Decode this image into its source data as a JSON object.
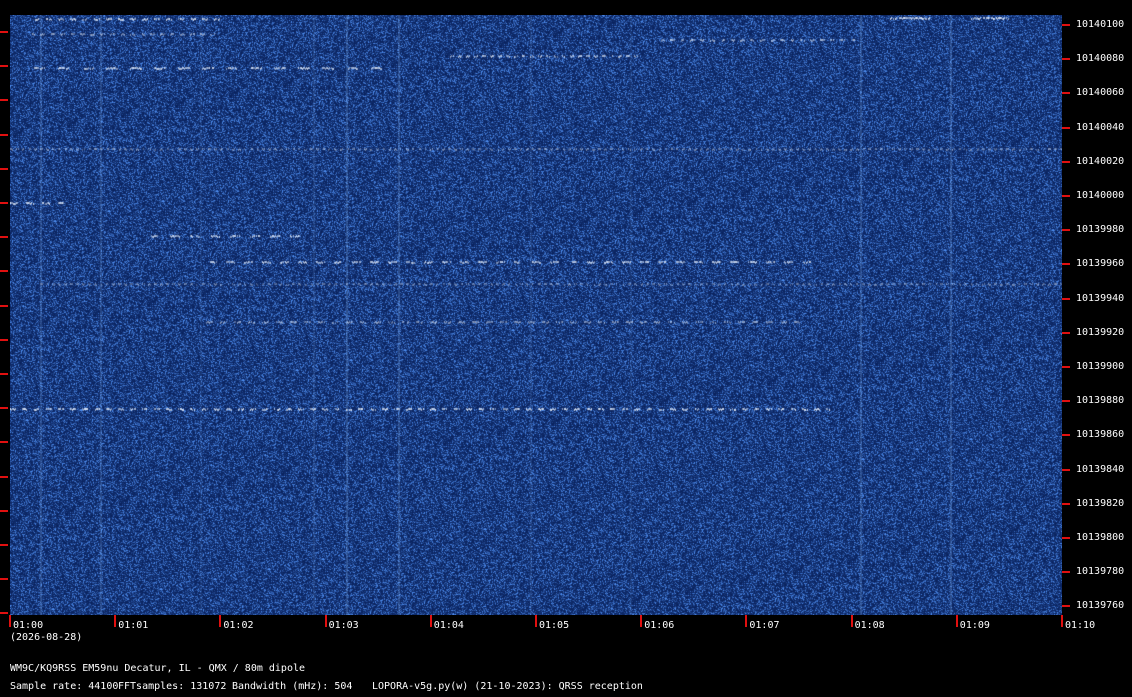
{
  "waterfall": {
    "date": "(2026-08-28)",
    "time_labels": [
      "01:00",
      "01:01",
      "01:02",
      "01:03",
      "01:04",
      "01:05",
      "01:06",
      "01:07",
      "01:08",
      "01:09",
      "01:10"
    ],
    "freq_labels": [
      "10140100",
      "10140080",
      "10140060",
      "10140040",
      "10140020",
      "10140000",
      "10139980",
      "10139960",
      "10139940",
      "10139920",
      "10139900",
      "10139880",
      "10139860",
      "10139840",
      "10139820",
      "10139800",
      "10139780",
      "10139760"
    ],
    "accent_color": "#e01010",
    "background_color": "#0f2c6e"
  },
  "footer": {
    "station": "WM9C/KQ9RSS EM59nu Decatur, IL - QMX / 80m dipole",
    "sample_rate": "Sample rate: 44100",
    "fft_samples": "FFTsamples: 131072",
    "bandwidth": "Bandwidth (mHz): 504",
    "software": "LOPORA-v5g.py(w) (21-10-2023): QRSS reception"
  }
}
